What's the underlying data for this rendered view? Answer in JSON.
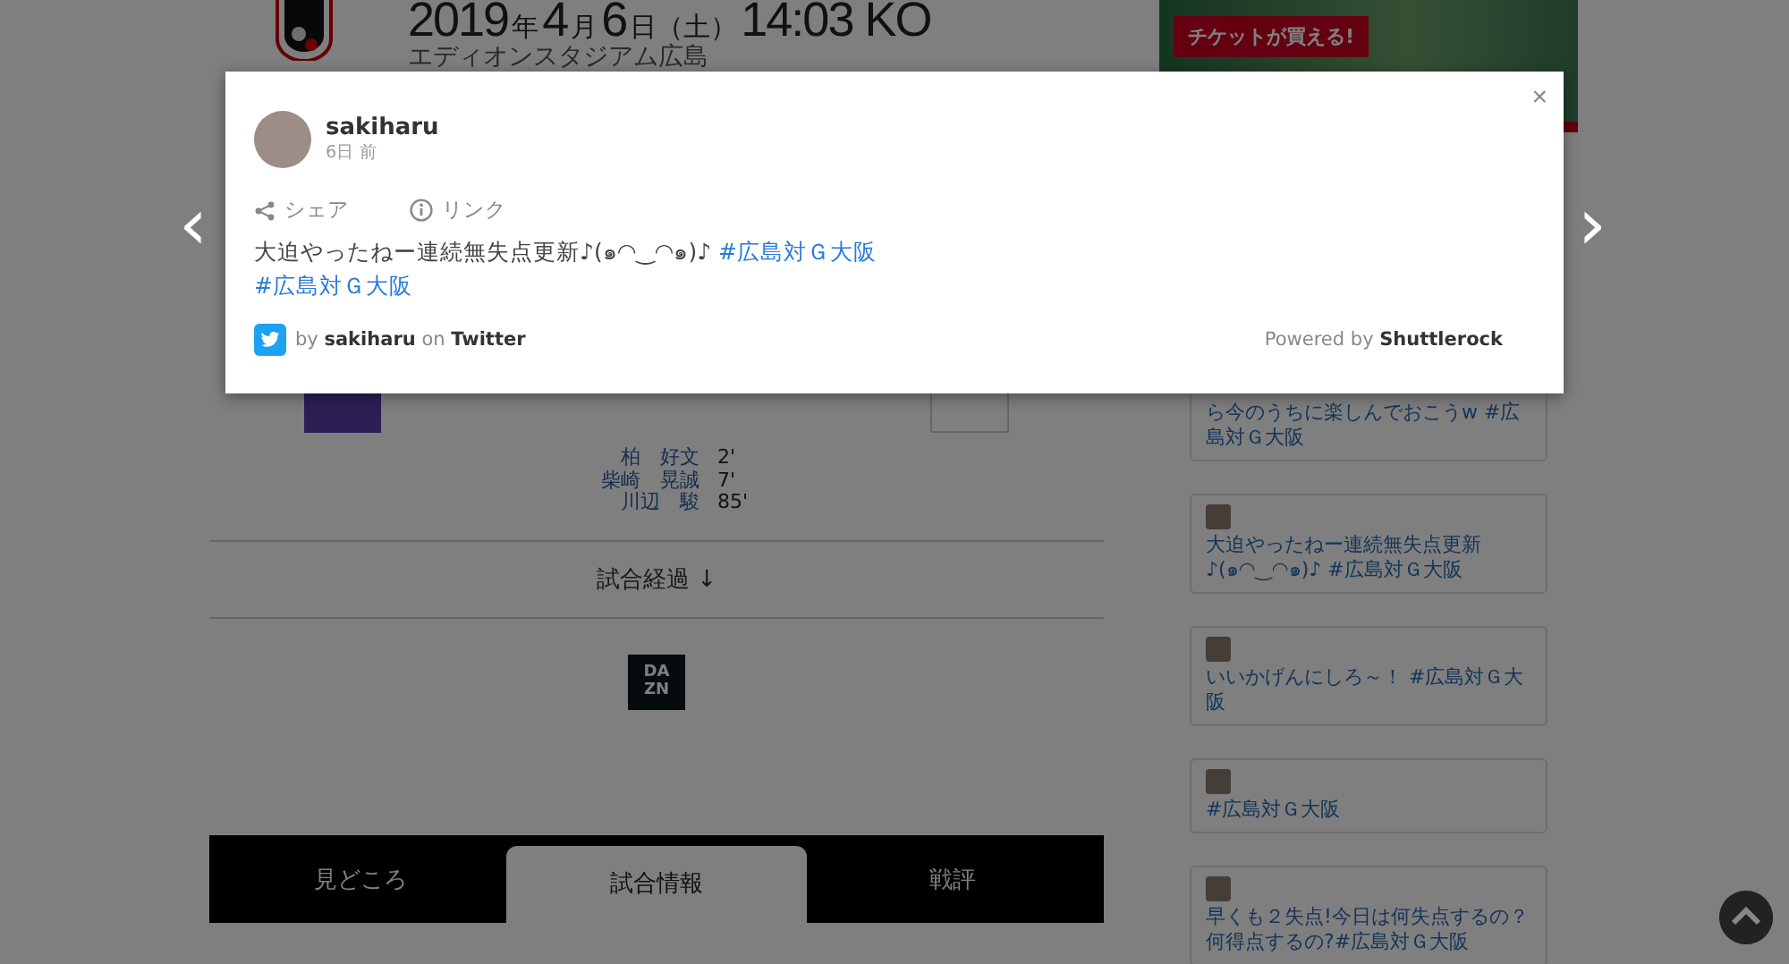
{
  "header": {
    "date_parts": [
      {
        "text": "2019",
        "kind": "big"
      },
      {
        "text": "年",
        "kind": "small"
      },
      {
        "text": "4",
        "kind": "big"
      },
      {
        "text": "月",
        "kind": "small"
      },
      {
        "text": "6",
        "kind": "big"
      },
      {
        "text": "日（土）",
        "kind": "small"
      },
      {
        "text": "14:03 KO",
        "kind": "big"
      }
    ],
    "venue": "エディオンスタジアム広島"
  },
  "scorers": [
    {
      "name": "柏　好文",
      "time": "2'"
    },
    {
      "name": "柴崎　晃誠",
      "time": "7'"
    },
    {
      "name": "川辺　駿",
      "time": "85'"
    }
  ],
  "progress_toggle": {
    "label": "試合経過",
    "arrow": "↓"
  },
  "broadcaster_logo": [
    "DA",
    "ZN"
  ],
  "tabs": [
    {
      "label": "見どころ",
      "selected": false
    },
    {
      "label": "試合情報",
      "selected": true
    },
    {
      "label": "戦評",
      "selected": false
    }
  ],
  "banner": {
    "lines": [
      "チケットが買える!"
    ]
  },
  "feed": [
    {
      "text": "ら今のうちに楽しんでおこうw #広島対Ｇ大阪",
      "avatar": false
    },
    {
      "text": "大迫やったねー連続無失点更新♪(๑◠‿◠๑)♪ #広島対Ｇ大阪",
      "avatar": true
    },
    {
      "text": "いいかげんにしろ～！ #広島対Ｇ大阪",
      "avatar": true
    },
    {
      "text": "#広島対Ｇ大阪",
      "avatar": true
    },
    {
      "text": "早くも２失点!今日は何失点するの？何得点するの?#広島対Ｇ大阪",
      "avatar": true
    }
  ],
  "nav": {
    "prev": "‹",
    "next": "›"
  },
  "modal": {
    "close": "×",
    "user": "sakiharu",
    "time": "6日 前",
    "actions": [
      {
        "kind": "share",
        "label": "シェア"
      },
      {
        "kind": "link",
        "label": "リンク"
      }
    ],
    "body": "大迫やったねー連続無失点更新♪(๑◠‿◠๑)♪ ",
    "hashtags": [
      "#広島対Ｇ大阪",
      "#広島対Ｇ大阪"
    ],
    "source": "by **sakiharu** on **Twitter**",
    "powered": "Powered by **Shuttlerock**"
  }
}
